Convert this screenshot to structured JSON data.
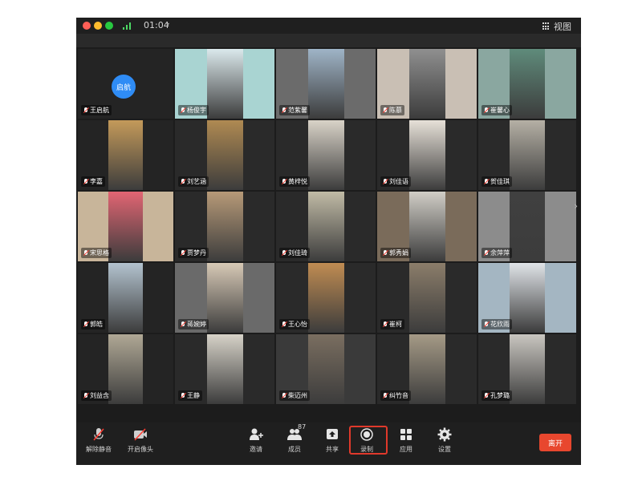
{
  "titlebar": {
    "timer": "01:04",
    "view_label": "视图"
  },
  "participants": [
    {
      "name": "王启航",
      "avatar": "启航",
      "bg": "#242424",
      "scene": ""
    },
    {
      "name": "杨俊宇",
      "bg": "#a9d4d2",
      "scene": "#dbe9ec"
    },
    {
      "name": "范紫馨",
      "bg": "#6b6b6b",
      "scene": "#9fb4c7"
    },
    {
      "name": "陈慕",
      "bg": "#c9bfb4",
      "scene": "#8f8f8f"
    },
    {
      "name": "崔馨心",
      "bg": "#8aa7a0",
      "scene": "#5f8b7b"
    },
    {
      "name": "李嘉",
      "bg": "#242424",
      "scene": "#c49a5a"
    },
    {
      "name": "刘艺涵",
      "bg": "#2a2a2a",
      "scene": "#b08a52"
    },
    {
      "name": "黄梓悦",
      "bg": "#2a2a2a",
      "scene": "#d9d3c8"
    },
    {
      "name": "刘佳语",
      "bg": "#2a2a2a",
      "scene": "#e7e1d8"
    },
    {
      "name": "贺佳琪",
      "bg": "#2a2a2a",
      "scene": "#b5b0a5"
    },
    {
      "name": "宋思格",
      "bg": "#c8b59a",
      "scene": "#e26573"
    },
    {
      "name": "贾梦丹",
      "bg": "#2a2a2a",
      "scene": "#b79a78"
    },
    {
      "name": "刘佳琦",
      "bg": "#2a2a2a",
      "scene": "#c1bba6"
    },
    {
      "name": "郭秀娟",
      "bg": "#7a6b5a",
      "scene": "#d1cec7"
    },
    {
      "name": "余萍萍",
      "bg": "#8c8c8c",
      "scene": "#404040"
    },
    {
      "name": "郭皓",
      "bg": "#242424",
      "scene": "#b3c3cf"
    },
    {
      "name": "蒋婉婷",
      "bg": "#6a6a6a",
      "scene": "#d7c9b6"
    },
    {
      "name": "王心怡",
      "bg": "#2a2a2a",
      "scene": "#c08c52"
    },
    {
      "name": "崔柯",
      "bg": "#2a2a2a",
      "scene": "#8b7d6a"
    },
    {
      "name": "花欣雨",
      "bg": "#a4b6c2",
      "scene": "#e0e4e8"
    },
    {
      "name": "刘益含",
      "bg": "#242424",
      "scene": "#b0a895"
    },
    {
      "name": "王静",
      "bg": "#2a2a2a",
      "scene": "#d6d2c8"
    },
    {
      "name": "柴迈州",
      "bg": "#3a3a3a",
      "scene": "#7a6e60"
    },
    {
      "name": "纠竹音",
      "bg": "#2a2a2a",
      "scene": "#a59a86"
    },
    {
      "name": "孔梦璐",
      "bg": "#2a2a2a",
      "scene": "#c9c6c0"
    }
  ],
  "toolbar": {
    "unmute": "解除静音",
    "start_video": "开启像头",
    "invite": "邀请",
    "members": "成员",
    "member_count": "87",
    "share": "共享",
    "record": "录制",
    "apps": "应用",
    "settings": "设置",
    "leave": "离开"
  },
  "colors": {
    "record_highlight": "#e0392b",
    "leave": "#e8472e",
    "avatar": "#2f8cf5"
  }
}
